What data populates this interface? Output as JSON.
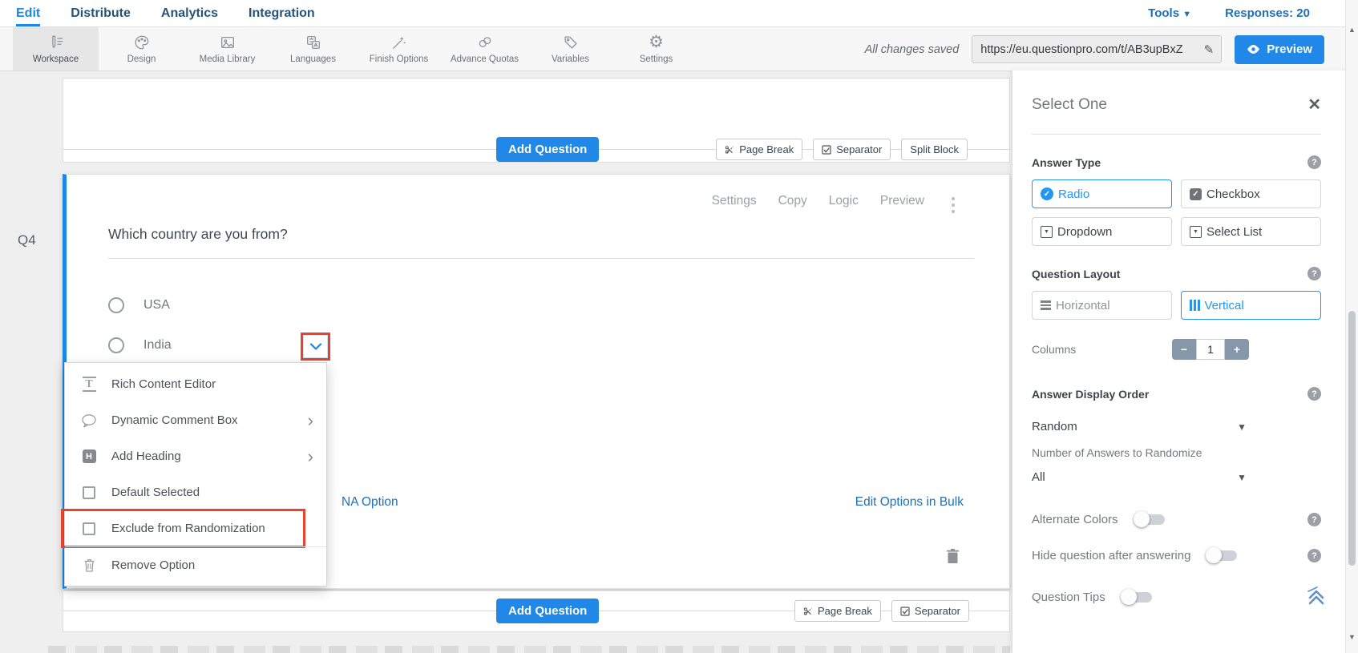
{
  "nav": {
    "items": [
      {
        "label": "Edit",
        "active": true
      },
      {
        "label": "Distribute",
        "active": false
      },
      {
        "label": "Analytics",
        "active": false
      },
      {
        "label": "Integration",
        "active": false
      }
    ],
    "tools_label": "Tools",
    "responses_label": "Responses: 20"
  },
  "toolbar": {
    "items": [
      {
        "label": "Workspace",
        "active": true
      },
      {
        "label": "Design"
      },
      {
        "label": "Media Library"
      },
      {
        "label": "Languages"
      },
      {
        "label": "Finish Options"
      },
      {
        "label": "Advance Quotas"
      },
      {
        "label": "Variables"
      },
      {
        "label": "Settings"
      }
    ],
    "saved_status": "All changes saved",
    "url_value": "https://eu.questionpro.com/t/AB3upBxZ",
    "preview_label": "Preview"
  },
  "canvas": {
    "add_question_label": "Add Question",
    "page_break_label": "Page Break",
    "separator_label": "Separator",
    "split_block_label": "Split Block",
    "question": {
      "number": "Q4",
      "actions": [
        {
          "label": "Settings"
        },
        {
          "label": "Copy"
        },
        {
          "label": "Logic"
        },
        {
          "label": "Preview"
        }
      ],
      "title": "Which country are you from?",
      "options": [
        {
          "label": "USA"
        },
        {
          "label": "India"
        }
      ],
      "na_option_label": "NA Option",
      "edit_bulk_label": "Edit Options in Bulk"
    },
    "option_menu": {
      "items": [
        {
          "label": "Rich Content Editor"
        },
        {
          "label": "Dynamic Comment Box"
        },
        {
          "label": "Add Heading"
        },
        {
          "label": "Default Selected"
        },
        {
          "label": "Exclude from Randomization"
        },
        {
          "label": "Remove Option"
        }
      ]
    }
  },
  "sidebar": {
    "title": "Select One",
    "answer_type": {
      "label": "Answer Type",
      "options": [
        {
          "label": "Radio",
          "selected": true
        },
        {
          "label": "Checkbox",
          "selected": false
        },
        {
          "label": "Dropdown",
          "selected": false
        },
        {
          "label": "Select List",
          "selected": false
        }
      ]
    },
    "question_layout": {
      "label": "Question Layout",
      "horizontal_label": "Horizontal",
      "vertical_label": "Vertical",
      "columns_label": "Columns",
      "columns_value": "1"
    },
    "answer_display_order": {
      "label": "Answer Display Order",
      "value": "Random",
      "randomize_label": "Number of Answers to Randomize",
      "randomize_value": "All"
    },
    "toggles": [
      {
        "label": "Alternate Colors",
        "on": false
      },
      {
        "label": "Hide question after answering",
        "on": false
      },
      {
        "label": "Question Tips",
        "on": false
      }
    ]
  },
  "colors": {
    "accent_blue": "#1b87e6",
    "nav_dark_blue": "#26537c",
    "link_blue": "#1e6fb8",
    "highlight_red": "#e8432d",
    "selected_border_blue": "#2196f3"
  }
}
